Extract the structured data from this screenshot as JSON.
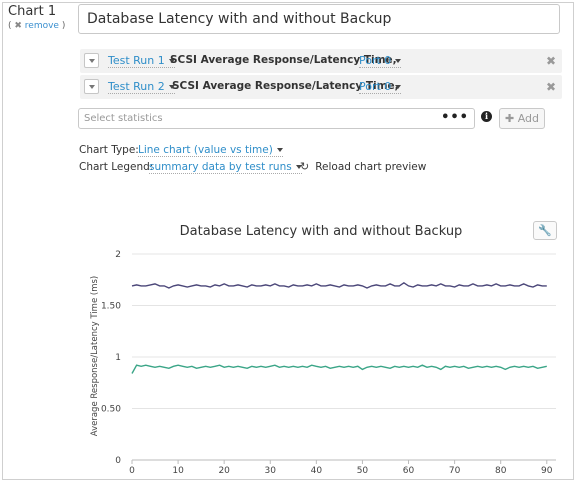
{
  "chart_section": {
    "label": "Chart 1",
    "remove_label": "remove",
    "title_value": "Database Latency with and without Backup"
  },
  "series_rows": [
    {
      "run": "Test Run 1",
      "metric": "SCSI Average Response/Latency Time,",
      "port": "Port 0"
    },
    {
      "run": "Test Run 2",
      "metric": "SCSI Average Response/Latency Time,",
      "port": "Port 0"
    }
  ],
  "stats": {
    "placeholder": "Select statistics",
    "add_label": "Add"
  },
  "options": {
    "chart_type_label": "Chart Type:",
    "chart_type_value": "Line chart (value vs time)",
    "legend_label": "Chart Legend:",
    "legend_value": "summary data by test runs",
    "reload_label": "Reload chart preview"
  },
  "icons": {
    "dropdown": "chevron-down-icon",
    "close": "close-icon",
    "more": "ellipsis-icon",
    "info": "info-icon",
    "add": "plus-icon",
    "reload": "refresh-icon",
    "settings": "wrench-icon"
  },
  "chart_data": {
    "type": "line",
    "title": "Database Latency with and without Backup",
    "xlabel": "",
    "ylabel": "Average Response/Latency Time (ms)",
    "xlim": [
      0,
      92
    ],
    "ylim": [
      0,
      2
    ],
    "x_ticks": [
      0,
      10,
      20,
      30,
      40,
      50,
      60,
      70,
      80,
      90
    ],
    "y_ticks": [
      0,
      0.5,
      1,
      1.5,
      2
    ],
    "y_tick_labels": [
      "0",
      "0.50",
      "1",
      "1.50",
      "2"
    ],
    "grid": "horizontal",
    "colors": [
      "#4b4779",
      "#3aa587"
    ],
    "series": [
      {
        "values": [
          1.69,
          1.7,
          1.69,
          1.69,
          1.7,
          1.71,
          1.69,
          1.69,
          1.67,
          1.69,
          1.7,
          1.69,
          1.68,
          1.69,
          1.7,
          1.69,
          1.69,
          1.68,
          1.7,
          1.69,
          1.71,
          1.69,
          1.69,
          1.7,
          1.69,
          1.68,
          1.7,
          1.69,
          1.69,
          1.7,
          1.69,
          1.71,
          1.69,
          1.69,
          1.68,
          1.7,
          1.69,
          1.69,
          1.7,
          1.69,
          1.71,
          1.69,
          1.69,
          1.7,
          1.69,
          1.68,
          1.7,
          1.69,
          1.69,
          1.7,
          1.69,
          1.67,
          1.69,
          1.7,
          1.69,
          1.69,
          1.71,
          1.69,
          1.69,
          1.72,
          1.69,
          1.68,
          1.7,
          1.69,
          1.69,
          1.7,
          1.69,
          1.71,
          1.69,
          1.69,
          1.68,
          1.7,
          1.69,
          1.69,
          1.71,
          1.69,
          1.69,
          1.7,
          1.69,
          1.71,
          1.69,
          1.69,
          1.7,
          1.69,
          1.69,
          1.71,
          1.69,
          1.68,
          1.7,
          1.69,
          1.69
        ]
      },
      {
        "values": [
          0.84,
          0.92,
          0.91,
          0.92,
          0.91,
          0.9,
          0.91,
          0.9,
          0.89,
          0.91,
          0.92,
          0.91,
          0.9,
          0.91,
          0.89,
          0.9,
          0.91,
          0.9,
          0.91,
          0.92,
          0.9,
          0.91,
          0.9,
          0.91,
          0.9,
          0.89,
          0.91,
          0.9,
          0.91,
          0.9,
          0.91,
          0.92,
          0.9,
          0.91,
          0.9,
          0.91,
          0.9,
          0.91,
          0.9,
          0.92,
          0.91,
          0.9,
          0.91,
          0.89,
          0.9,
          0.91,
          0.9,
          0.91,
          0.9,
          0.91,
          0.88,
          0.9,
          0.91,
          0.9,
          0.91,
          0.9,
          0.89,
          0.91,
          0.9,
          0.91,
          0.9,
          0.91,
          0.9,
          0.92,
          0.9,
          0.91,
          0.9,
          0.88,
          0.91,
          0.9,
          0.91,
          0.9,
          0.91,
          0.89,
          0.9,
          0.91,
          0.9,
          0.91,
          0.9,
          0.91,
          0.9,
          0.88,
          0.9,
          0.91,
          0.9,
          0.91,
          0.9,
          0.91,
          0.89,
          0.9,
          0.91
        ]
      }
    ]
  }
}
